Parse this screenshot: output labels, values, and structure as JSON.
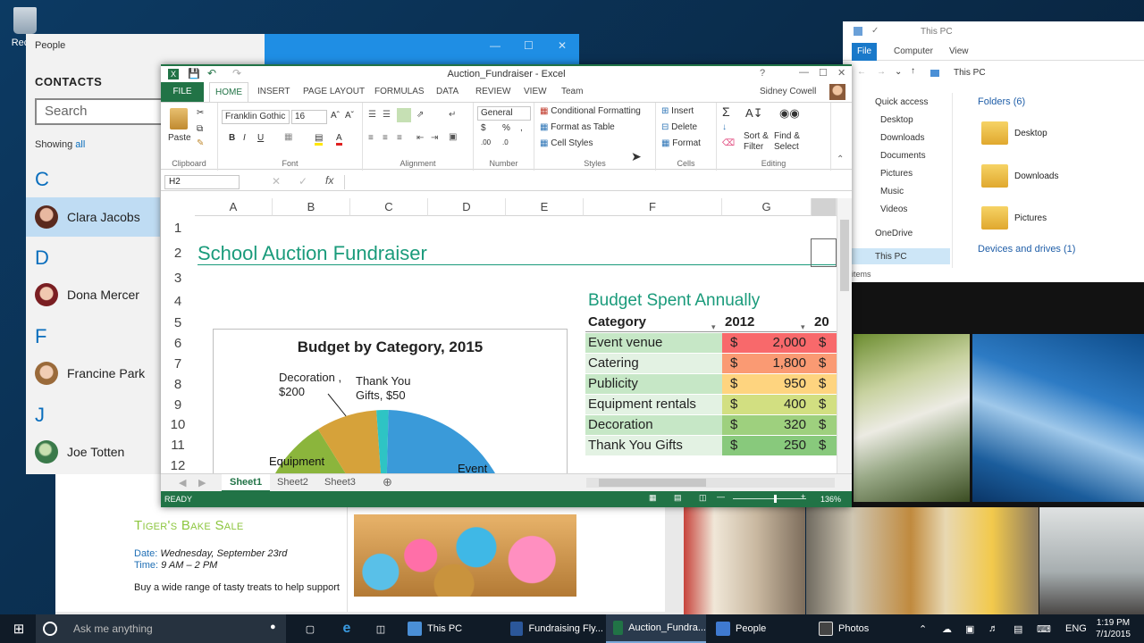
{
  "desktop": {
    "recycle_label": "Recyc"
  },
  "people": {
    "window_title": "People",
    "heading": "CONTACTS",
    "search_placeholder": "Search",
    "showing_prefix": "Showing",
    "showing_link": "all",
    "letters": [
      "C",
      "D",
      "F",
      "J"
    ],
    "contacts": [
      "Clara Jacobs",
      "Dona Mercer",
      "Francine Park",
      "Joe Totten"
    ],
    "selected": "Clara Jacobs"
  },
  "explorer": {
    "title": "This PC",
    "tabs": [
      "File",
      "Computer",
      "View"
    ],
    "address": "This PC",
    "nav": {
      "quick_access": "Quick access",
      "items": [
        "Desktop",
        "Downloads",
        "Documents",
        "Pictures",
        "Music",
        "Videos"
      ],
      "onedrive": "OneDrive",
      "thispc": "This PC"
    },
    "folders_header": "Folders (6)",
    "folders": [
      "Desktop",
      "Downloads",
      "Pictures"
    ],
    "devices_header": "Devices and drives (1)",
    "status": "items"
  },
  "excel": {
    "title": "Auction_Fundraiser - Excel",
    "tabs": [
      "FILE",
      "HOME",
      "INSERT",
      "PAGE LAYOUT",
      "FORMULAS",
      "DATA",
      "REVIEW",
      "VIEW",
      "Team"
    ],
    "user": "Sidney Cowell",
    "ribbon": {
      "clipboard": "Clipboard",
      "paste": "Paste",
      "font": "Font",
      "font_name": "Franklin Gothic",
      "font_size": "16",
      "alignment": "Alignment",
      "number": "Number",
      "number_format": "General",
      "styles": "Styles",
      "conditional": "Conditional Formatting",
      "format_table": "Format as Table",
      "cell_styles": "Cell Styles",
      "cells": "Cells",
      "insert": "Insert",
      "delete": "Delete",
      "format": "Format",
      "editing": "Editing",
      "sort": "Sort &",
      "filter": "Filter",
      "find": "Find &",
      "select": "Select"
    },
    "name_box": "H2",
    "columns": [
      "A",
      "B",
      "C",
      "D",
      "E",
      "F",
      "G"
    ],
    "rows": [
      "1",
      "2",
      "3",
      "4",
      "5",
      "6",
      "7",
      "8",
      "9",
      "10",
      "11",
      "12"
    ],
    "sheet_title": "School Auction Fundraiser",
    "budget_title": "Budget Spent Annually",
    "table": {
      "headers": [
        "Category",
        "2012",
        "20"
      ],
      "rows": [
        {
          "category": "Event venue",
          "currency": "$",
          "amount": "2,000",
          "next": "$",
          "color": "#f8696b"
        },
        {
          "category": "Catering",
          "currency": "$",
          "amount": "1,800",
          "next": "$",
          "color": "#fa9a73"
        },
        {
          "category": "Publicity",
          "currency": "$",
          "amount": "950",
          "next": "$",
          "color": "#fed47f"
        },
        {
          "category": "Equipment rentals",
          "currency": "$",
          "amount": "400",
          "next": "$",
          "color": "#d2df81"
        },
        {
          "category": "Decoration",
          "currency": "$",
          "amount": "320",
          "next": "$",
          "color": "#9ed07e"
        },
        {
          "category": "Thank You Gifts",
          "currency": "$",
          "amount": "250",
          "next": "$",
          "color": "#88c97c"
        }
      ]
    },
    "sheets": [
      "Sheet1",
      "Sheet2",
      "Sheet3"
    ],
    "status": "READY",
    "zoom": "136%"
  },
  "chart_data": {
    "type": "pie",
    "title": "Budget by Category, 2015",
    "slices": [
      {
        "label": "Event",
        "value": null,
        "color": "#3a9ad9"
      },
      {
        "label": "Equipment",
        "value": null,
        "color": "#8bb53c"
      },
      {
        "label": "Decoration",
        "value": 200,
        "label_text": "Decoration , $200",
        "color": "#d6a23a"
      },
      {
        "label": "Thank You Gifts",
        "value": 50,
        "label_text": "Thank You Gifts, $50",
        "color": "#2ec4c4"
      }
    ]
  },
  "word": {
    "title": "Tiger's Bake Sale",
    "date_label": "Date:",
    "date_value": "Wednesday, September 23rd",
    "time_label": "Time:",
    "time_value": "9 AM – 2 PM",
    "body": "Buy a wide range of tasty treats to help support"
  },
  "taskbar": {
    "search_placeholder": "Ask me anything",
    "apps": [
      "This PC",
      "Fundraising Fly...",
      "Auction_Fundra...",
      "People",
      "Photos"
    ],
    "language": "ENG",
    "time": "1:19 PM",
    "date": "7/1/2015"
  }
}
